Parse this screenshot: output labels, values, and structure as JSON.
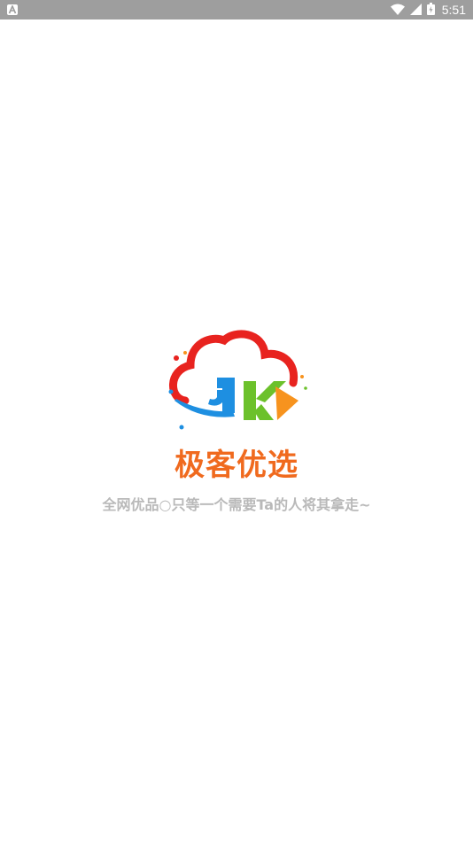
{
  "status_bar": {
    "time": "5:51",
    "icons": [
      "notification-a-icon",
      "wifi-icon",
      "signal-icon",
      "battery-icon"
    ]
  },
  "splash": {
    "brand_name": "极客优选",
    "slogan": "全网优品○只等一个需要Ta的人将其拿走~",
    "logo_text": "JK",
    "colors": {
      "cloud": "#e8231f",
      "j_blue": "#1e8fe1",
      "k_green": "#6cc12b",
      "k_orange": "#f7931e",
      "brand": "#f06a1e",
      "slogan": "#b9b9b9"
    }
  }
}
